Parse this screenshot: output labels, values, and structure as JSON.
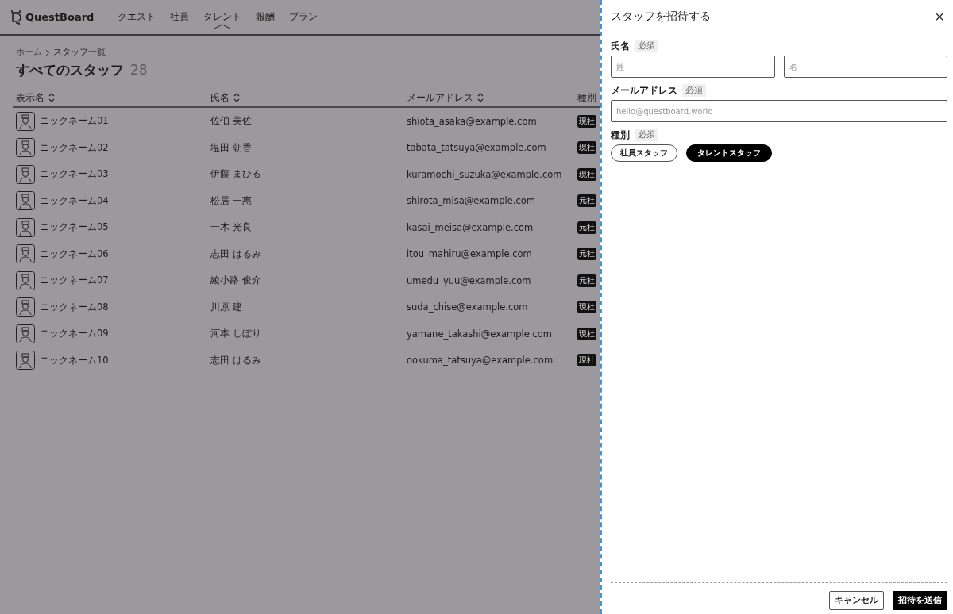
{
  "header": {
    "logo": "QuestBoard",
    "nav": [
      {
        "label": "クエスト",
        "selected": false
      },
      {
        "label": "社員",
        "selected": false
      },
      {
        "label": "タレント",
        "selected": true
      },
      {
        "label": "報酬",
        "selected": false
      },
      {
        "label": "プラン",
        "selected": false
      }
    ]
  },
  "breadcrumb": [
    "ホーム",
    "スタッフ一覧"
  ],
  "page_title": "すべてのスタッフ",
  "count": "28",
  "table": {
    "columns": [
      {
        "label": "表示名",
        "sortable": true
      },
      {
        "label": "氏名",
        "sortable": true
      },
      {
        "label": "メールアドレス",
        "sortable": true
      },
      {
        "label": "種別",
        "sortable": false
      }
    ],
    "rows": [
      {
        "display_name": "ニックネーム01",
        "name": "佐伯 美佐",
        "email": "shiota_asaka@example.com",
        "type": "現社"
      },
      {
        "display_name": "ニックネーム02",
        "name": "塩田 朝香",
        "email": "tabata_tatsuya@example.com",
        "type": "現社"
      },
      {
        "display_name": "ニックネーム03",
        "name": "伊藤 まひる",
        "email": "kuramochi_suzuka@example.com",
        "type": "現社"
      },
      {
        "display_name": "ニックネーム04",
        "name": "松居 一惠",
        "email": "shirota_misa@example.com",
        "type": "元社"
      },
      {
        "display_name": "ニックネーム05",
        "name": "一木 光良",
        "email": "kasai_meisa@example.com",
        "type": "元社"
      },
      {
        "display_name": "ニックネーム06",
        "name": "志田 はるみ",
        "email": "itou_mahiru@example.com",
        "type": "元社"
      },
      {
        "display_name": "ニックネーム07",
        "name": "綾小路 俊介",
        "email": "umedu_yuu@example.com",
        "type": "元社"
      },
      {
        "display_name": "ニックネーム08",
        "name": "川原 建",
        "email": "suda_chise@example.com",
        "type": "現社"
      },
      {
        "display_name": "ニックネーム09",
        "name": "河本 しぼり",
        "email": "yamane_takashi@example.com",
        "type": "現社"
      },
      {
        "display_name": "ニックネーム10",
        "name": "志田 はるみ",
        "email": "ookuma_tatsuya@example.com",
        "type": "現社"
      }
    ]
  },
  "panel": {
    "title": "スタッフを招待する",
    "close": "×",
    "name_label": "氏名",
    "name_required": "必須",
    "last_name": {
      "placeholder": "姓"
    },
    "first_name": {
      "placeholder": "名"
    },
    "email_label": "メールアドレス",
    "email_required": "必須",
    "email": {
      "placeholder": "hello@questboard.world"
    },
    "type_label": "種別",
    "type_required": "必須",
    "type_options": [
      {
        "label": "社員スタッフ",
        "selected": false
      },
      {
        "label": "タレントスタッフ",
        "selected": true
      }
    ],
    "cancel": "キャンセル",
    "submit": "招待を送信"
  }
}
